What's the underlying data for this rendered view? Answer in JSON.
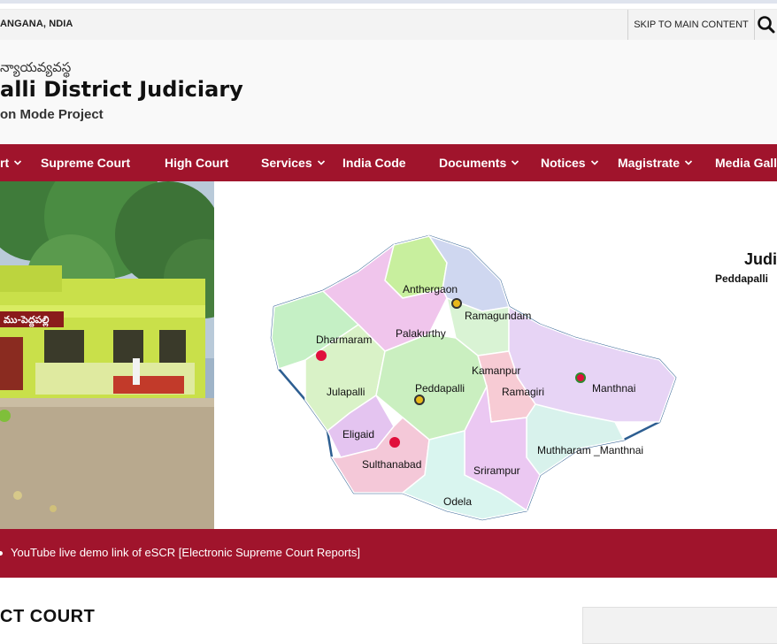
{
  "util": {
    "location": "ANGANA, NDIA",
    "skip_link": "SKIP TO MAIN CONTENT"
  },
  "header": {
    "telugu": "న్యాయవ్యవస్థ",
    "title": "alli District Judiciary",
    "subtitle": "on Mode Project"
  },
  "nav": {
    "items": [
      {
        "label": "rt",
        "dropdown": true
      },
      {
        "label": "Supreme Court",
        "dropdown": false
      },
      {
        "label": "High Court",
        "dropdown": false
      },
      {
        "label": "Services",
        "dropdown": true
      },
      {
        "label": "India Code",
        "dropdown": false
      },
      {
        "label": "Documents",
        "dropdown": true
      },
      {
        "label": "Notices",
        "dropdown": true
      },
      {
        "label": "Magistrate",
        "dropdown": true
      },
      {
        "label": "Media Gall",
        "dropdown": false
      }
    ]
  },
  "hero": {
    "photo_sign": "ము-పెద్దపల్లి",
    "map_regions": [
      "Anthergaon",
      "Ramagundam",
      "Dharmaram",
      "Palakurthy",
      "Kamanpur",
      "Manthnai",
      "Julapalli",
      "Peddapalli",
      "Ramagiri",
      "Eligaid",
      "Sulthanabad",
      "Muthharam _Manthnai",
      "Srirampur",
      "Odela"
    ],
    "caption_title": "Judi",
    "caption_sub": "Peddapalli"
  },
  "ticker": {
    "text": "YouTube live demo link of eSCR [Electronic Supreme Court Reports]"
  },
  "main": {
    "section_heading": "CT COURT"
  },
  "colors": {
    "brand": "#a0142c",
    "utility_bg": "#f3f3f3"
  },
  "icons": {
    "search": "search-icon",
    "dropdown": "chevron-down-icon"
  }
}
